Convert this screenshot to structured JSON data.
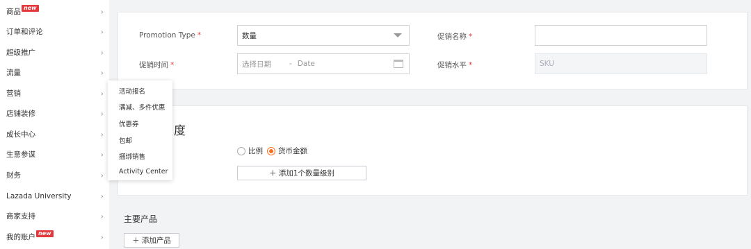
{
  "sidebar": {
    "items": [
      {
        "label": "商品",
        "badge": "new"
      },
      {
        "label": "订单和评论"
      },
      {
        "label": "超级推广"
      },
      {
        "label": "流量"
      },
      {
        "label": "营销"
      },
      {
        "label": "店铺装修"
      },
      {
        "label": "成长中心"
      },
      {
        "label": "生意参谋"
      },
      {
        "label": "财务"
      },
      {
        "label": "Lazada University"
      },
      {
        "label": "商家支持"
      },
      {
        "label": "我的账户",
        "badge": "new"
      }
    ],
    "chevron": "›"
  },
  "submenu": {
    "items": [
      "活动报名",
      "满减、多件优惠",
      "优惠券",
      "包邮",
      "捆绑销售",
      "Activity Center"
    ]
  },
  "form": {
    "promotion_type_label": "Promotion Type",
    "promotion_type_value": "数量",
    "promotion_name_label": "促销名称",
    "promotion_name_value": "",
    "promotion_time_label": "促销时间",
    "date_start_placeholder": "选择日期",
    "date_sep": "-",
    "date_end_placeholder": "Date",
    "promotion_level_label": "促销水平",
    "promotion_level_value": "SKU",
    "required_mark": "*"
  },
  "tier": {
    "title_fragment": "度",
    "options": [
      "比例",
      "货币金额"
    ],
    "selected": "货币金额",
    "add_tier_button": "＋ 添加1个数量级别"
  },
  "products": {
    "title": "主要产品",
    "add_button": "＋ 添加产品"
  },
  "colors": {
    "accent": "#f57224",
    "required": "#e4393c",
    "badge": "#e4393c"
  }
}
